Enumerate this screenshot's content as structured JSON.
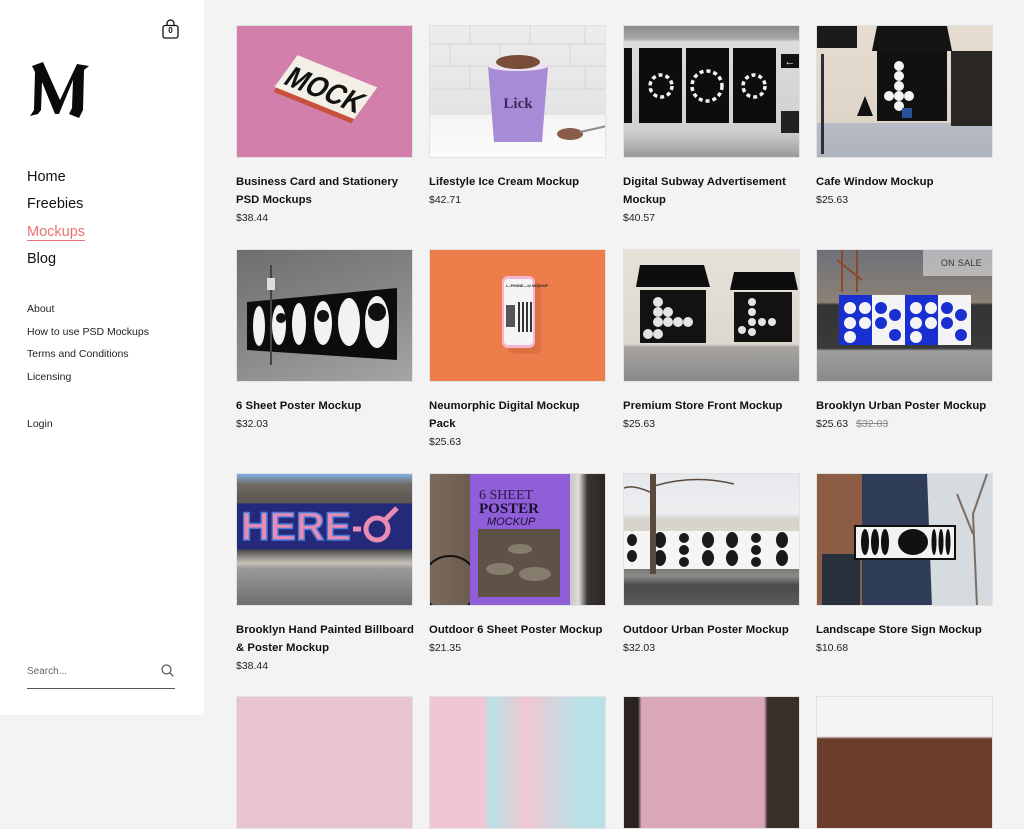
{
  "cart": {
    "icon": "shopping-bag-icon",
    "count": "0"
  },
  "logo": {
    "letter": "M"
  },
  "main_nav": [
    {
      "label": "Home",
      "active": false
    },
    {
      "label": "Freebies",
      "active": false
    },
    {
      "label": "Mockups",
      "active": true
    },
    {
      "label": "Blog",
      "active": false
    }
  ],
  "sub_nav": [
    {
      "label": "About"
    },
    {
      "label": "How to use PSD Mockups"
    },
    {
      "label": "Terms and Conditions"
    },
    {
      "label": "Licensing"
    }
  ],
  "login": {
    "label": "Login"
  },
  "search": {
    "placeholder": "Search...",
    "icon": "search-icon"
  },
  "colors": {
    "accent": "#e8746f",
    "sidebar_bg": "#ffffff",
    "page_bg": "#f3f3f3"
  },
  "products": [
    {
      "title": "Business Card and Stationery PSD Mockups",
      "price": "$38.44",
      "image": "pink-mock-business-card"
    },
    {
      "title": "Lifestyle Ice Cream Mockup",
      "price": "$42.71",
      "image": "purple-ice-cream-tub"
    },
    {
      "title": "Digital Subway Advertisement Mockup",
      "price": "$40.57",
      "image": "subway-spiral-posters"
    },
    {
      "title": "Cafe Window Mockup",
      "price": "$25.63",
      "image": "cafe-storefront"
    },
    {
      "title": "6 Sheet Poster Mockup",
      "price": "$32.03",
      "image": "street-poster-wall"
    },
    {
      "title": "Neumorphic Digital Mockup Pack",
      "price": "$25.63",
      "image": "phone-on-orange"
    },
    {
      "title": "Premium Store Front Mockup",
      "price": "$25.63",
      "image": "store-front-awnings"
    },
    {
      "title": "Brooklyn Urban Poster Mockup",
      "price": "$25.63",
      "old_price": "$32.03",
      "badge": "ON SALE",
      "image": "blue-poster-wall"
    },
    {
      "title": "Brooklyn Hand Painted Billboard & Poster Mockup",
      "price": "$38.44",
      "image": "here-billboard"
    },
    {
      "title": "Outdoor 6 Sheet Poster Mockup",
      "price": "$21.35",
      "image": "purple-6-sheet-poster"
    },
    {
      "title": "Outdoor Urban Poster Mockup",
      "price": "$32.03",
      "image": "urban-poster-fence"
    },
    {
      "title": "Landscape Store Sign Mockup",
      "price": "$10.68",
      "image": "store-sign"
    },
    {
      "title": "",
      "price": "",
      "image": "pink-texture"
    },
    {
      "title": "",
      "price": "",
      "image": "pastel-cards"
    },
    {
      "title": "",
      "price": "",
      "image": "pink-wall"
    },
    {
      "title": "",
      "price": "",
      "image": "brick-building"
    }
  ],
  "image_text": {
    "mock": "MOCK",
    "lick": "Lick",
    "phone": "I—PHONE—12 MOCKUP",
    "six_sheet": "6 SHEET",
    "poster": "POSTER",
    "mockup": "MOCKUP",
    "here": "HERE"
  }
}
